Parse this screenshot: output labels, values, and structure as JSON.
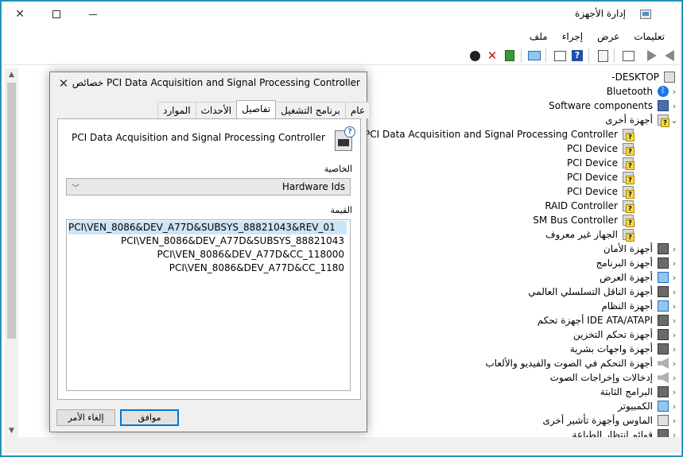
{
  "window": {
    "title": "إدارة الأجهزة"
  },
  "menu": [
    "ملف",
    "إجراء",
    "عرض",
    "تعليمات"
  ],
  "tree": {
    "root": "DESKTOP-",
    "items": [
      {
        "label": "Bluetooth",
        "icon": "bluetooth-icon",
        "expander": "‹"
      },
      {
        "label": "Software components",
        "icon": "software-components-icon",
        "expander": "‹"
      },
      {
        "label": "أجهزة أخرى",
        "icon": "other-devices-icon",
        "expander": "⌄"
      },
      {
        "label": "PCI Data Acquisition and Signal Processing Controller",
        "icon": "unknown-device-icon",
        "child": true
      },
      {
        "label": "PCI Device",
        "icon": "unknown-device-icon",
        "child": true
      },
      {
        "label": "PCI Device",
        "icon": "unknown-device-icon",
        "child": true
      },
      {
        "label": "PCI Device",
        "icon": "unknown-device-icon",
        "child": true
      },
      {
        "label": "PCI Device",
        "icon": "unknown-device-icon",
        "child": true
      },
      {
        "label": "RAID Controller",
        "icon": "unknown-device-icon",
        "child": true
      },
      {
        "label": "SM Bus Controller",
        "icon": "unknown-device-icon",
        "child": true
      },
      {
        "label": "الجهاز غير معروف",
        "icon": "unknown-device-icon",
        "child": true
      },
      {
        "label": "أجهزة الأمان",
        "icon": "security-devices-icon",
        "expander": "‹"
      },
      {
        "label": "أجهزة البرنامج",
        "icon": "software-devices-icon",
        "expander": "‹"
      },
      {
        "label": "أجهزة العرض",
        "icon": "display-adapters-icon",
        "expander": "‹"
      },
      {
        "label": "أجهزة الناقل التسلسلي العالمي",
        "icon": "usb-controllers-icon",
        "expander": "‹"
      },
      {
        "label": "أجهزة النظام",
        "icon": "system-devices-icon",
        "expander": "‹"
      },
      {
        "label": "IDE ATA/ATAPI أجهزة تحكم",
        "icon": "ide-controllers-icon",
        "expander": "‹"
      },
      {
        "label": "أجهزة تحكم التخزين",
        "icon": "storage-controllers-icon",
        "expander": "‹"
      },
      {
        "label": "أجهزة واجهات بشرية",
        "icon": "hid-devices-icon",
        "expander": "‹"
      },
      {
        "label": "أجهزة التحكم في الصوت والفيديو والألعاب",
        "icon": "sound-video-icon",
        "expander": "‹"
      },
      {
        "label": "إدخالات وإخراجات الصوت",
        "icon": "audio-io-icon",
        "expander": "‹"
      },
      {
        "label": "البرامج الثابتة",
        "icon": "firmware-icon",
        "expander": "‹"
      },
      {
        "label": "الكمبيوتر",
        "icon": "computer-icon",
        "expander": "‹"
      },
      {
        "label": "الماوس وأجهزة تأشير أخرى",
        "icon": "mouse-icon",
        "expander": "‹"
      },
      {
        "label": "قوائم انتظار الطباعة",
        "icon": "print-queues-icon",
        "expander": "‹"
      }
    ]
  },
  "dialog": {
    "title": "خصائص PCI Data Acquisition and Signal Processing Controller",
    "tabs": [
      "عام",
      "برنامج التشغيل",
      "تفاصيل",
      "الأحداث",
      "الموارد"
    ],
    "active_tab": "تفاصيل",
    "device_name": "PCI Data Acquisition and Signal Processing Controller",
    "property_label": "الخاصية",
    "property_value": "Hardware Ids",
    "value_label": "القيمة",
    "values": [
      "PCI\\VEN_8086&DEV_A77D&SUBSYS_88821043&REV_01",
      "PCI\\VEN_8086&DEV_A77D&SUBSYS_88821043",
      "PCI\\VEN_8086&DEV_A77D&CC_118000",
      "PCI\\VEN_8086&DEV_A77D&CC_1180"
    ],
    "ok_label": "موافق",
    "cancel_label": "إلغاء الأمر"
  }
}
